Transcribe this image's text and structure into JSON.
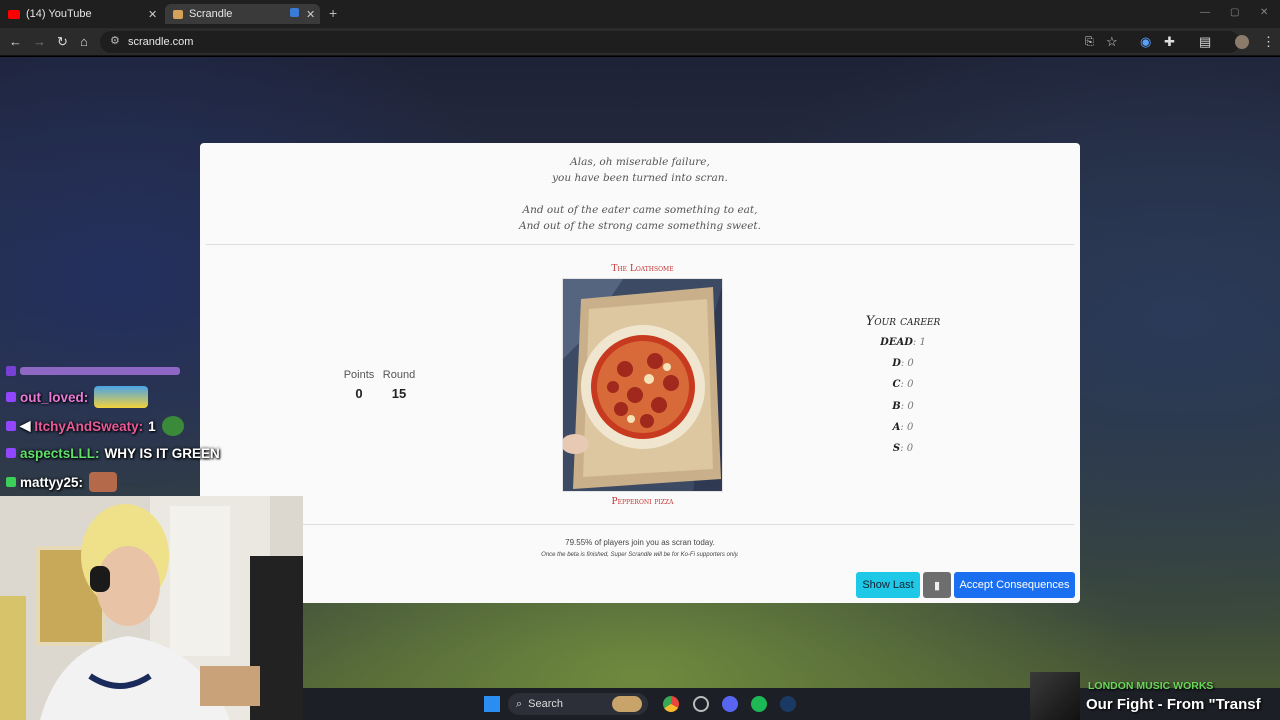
{
  "browser": {
    "tabs": [
      {
        "title": "(14) YouTube",
        "active": false,
        "favicon": "youtube-icon"
      },
      {
        "title": "Scrandle",
        "active": true,
        "favicon": "scrandle-icon"
      }
    ],
    "url": "scrandle.com"
  },
  "modal": {
    "poem_lines": [
      "Alas, oh miserable failure,",
      "you have been turned into scran.",
      "And out of the eater came something to eat,",
      "And out of the strong came something sweet."
    ],
    "points_label": "Points",
    "points_value": "0",
    "round_label": "Round",
    "round_value": "15",
    "category_title": "The Loathsome",
    "food_name": "Pepperoni pizza",
    "career": {
      "title": "Your career",
      "rows": [
        {
          "grade": "DEAD",
          "count": "1"
        },
        {
          "grade": "D",
          "count": "0"
        },
        {
          "grade": "C",
          "count": "0"
        },
        {
          "grade": "B",
          "count": "0"
        },
        {
          "grade": "A",
          "count": "0"
        },
        {
          "grade": "S",
          "count": "0"
        }
      ]
    },
    "stat_line": "79.55% of players join you as scran today.",
    "beta_note": "Once the beta is finished, Super Scrandle will be for Ko-Fi supporters only.",
    "buttons": {
      "show_last": "Show Last",
      "accept": "Accept Consequences"
    }
  },
  "chat": [
    {
      "user": "out_loved:",
      "message": "",
      "color": "#e87ad8"
    },
    {
      "user": "ItchyAndSweaty:",
      "message": "1",
      "color": "#e85a9a"
    },
    {
      "user": "aspectsLLL:",
      "message": "WHY IS IT GREEN",
      "color": "#5ee06a"
    },
    {
      "user": "mattyy25:",
      "message": "",
      "color": "#ffffff"
    }
  ],
  "taskbar": {
    "search_label": "Search"
  },
  "now_playing": {
    "artist": "LONDON MUSIC WORKS",
    "song": "Our Fight - From \"Transf"
  }
}
